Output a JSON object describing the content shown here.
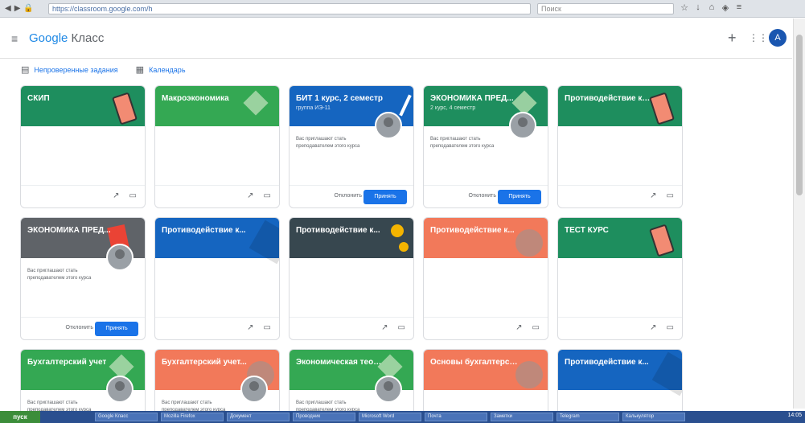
{
  "browser": {
    "address": "https://classroom.google.com/h",
    "search_placeholder": "Поиск",
    "nav_icons": [
      "back-icon",
      "forward-icon",
      "lock-icon"
    ],
    "toolbar_icons": [
      "star-icon",
      "download-icon",
      "home-icon",
      "shield-icon",
      "menu-icon"
    ]
  },
  "header": {
    "menu_icon": "≡",
    "brand": "Google",
    "product": "Класс",
    "plus": "+",
    "apps": "⋮⋮⋮",
    "avatar_initial": "А"
  },
  "links": {
    "calendar": "Непроверенные задания",
    "todo": "Календарь"
  },
  "cards": [
    {
      "title": "СКИП",
      "subtitle": "",
      "color": "#1e8e5e",
      "deco": "phone",
      "desc": "",
      "mode": "icons"
    },
    {
      "title": "Макроэкономика",
      "subtitle": "",
      "color": "#34a853",
      "deco": "diamond",
      "desc": "",
      "mode": "icons"
    },
    {
      "title": "БИТ 1 курс, 2 семестр",
      "subtitle": "группа ИЭ-11",
      "color": "#1565c0",
      "deco": "pencil",
      "desc": "Вас приглашают стать преподавателем этого курса",
      "mode": "invite"
    },
    {
      "title": "ЭКОНОМИКА ПРЕД...",
      "subtitle": "2 курс, 4 семестр",
      "color": "#1e8e5e",
      "deco": "diamond",
      "desc": "Вас приглашают стать преподавателем этого курса",
      "mode": "invite"
    },
    {
      "title": "Противодействие коррупции",
      "subtitle": "",
      "color": "#1e8e5e",
      "deco": "phone",
      "desc": "",
      "mode": "icons"
    },
    {
      "title": "ЭКОНОМИКА ПРЕД...",
      "subtitle": "",
      "color": "#5f6368",
      "deco": "book",
      "desc": "Вас приглашают стать преподавателем этого курса",
      "mode": "invite"
    },
    {
      "title": "Противодействие к...",
      "subtitle": "",
      "color": "#1565c0",
      "deco": "wedge",
      "desc": "",
      "mode": "icons"
    },
    {
      "title": "Противодействие к...",
      "subtitle": "",
      "color": "#37474f",
      "deco": "coin",
      "desc": "",
      "mode": "icons"
    },
    {
      "title": "Противодействие к...",
      "subtitle": "",
      "color": "#f2795a",
      "deco": "gear",
      "desc": "",
      "mode": "icons"
    },
    {
      "title": "ТЕСТ КУРС",
      "subtitle": "",
      "color": "#1e8e5e",
      "deco": "phone",
      "desc": "",
      "mode": "icons"
    },
    {
      "title": "Бухгалтерский учет",
      "subtitle": "",
      "color": "#34a853",
      "deco": "diamond",
      "desc": "Вас приглашают стать преподавателем этого курса",
      "mode": "invite"
    },
    {
      "title": "Бухгалтерский учет...",
      "subtitle": "",
      "color": "#f2795a",
      "deco": "gear",
      "desc": "Вас приглашают стать преподавателем этого курса",
      "mode": "invite"
    },
    {
      "title": "Экономическая теория",
      "subtitle": "",
      "color": "#34a853",
      "deco": "diamond",
      "desc": "Вас приглашают стать преподавателем этого курса",
      "mode": "invite"
    },
    {
      "title": "Основы бухгалтерского...",
      "subtitle": "",
      "color": "#f2795a",
      "deco": "gear",
      "desc": "",
      "mode": "icons"
    },
    {
      "title": "Противодействие к...",
      "subtitle": "",
      "color": "#1565c0",
      "deco": "wedge",
      "desc": "",
      "mode": "icons"
    }
  ],
  "card_actions": {
    "decline": "Отклонить",
    "accept": "Принять",
    "trend_icon": "trending-icon",
    "folder_icon": "folder-icon"
  },
  "taskbar": {
    "start": "пуск",
    "tasks": [
      "Google Класс",
      "Mozilla Firefox",
      "Документ",
      "Проводник",
      "Microsoft Word",
      "Почта",
      "Заметки",
      "Telegram",
      "Калькулятор"
    ],
    "tray_time": "14:05"
  }
}
